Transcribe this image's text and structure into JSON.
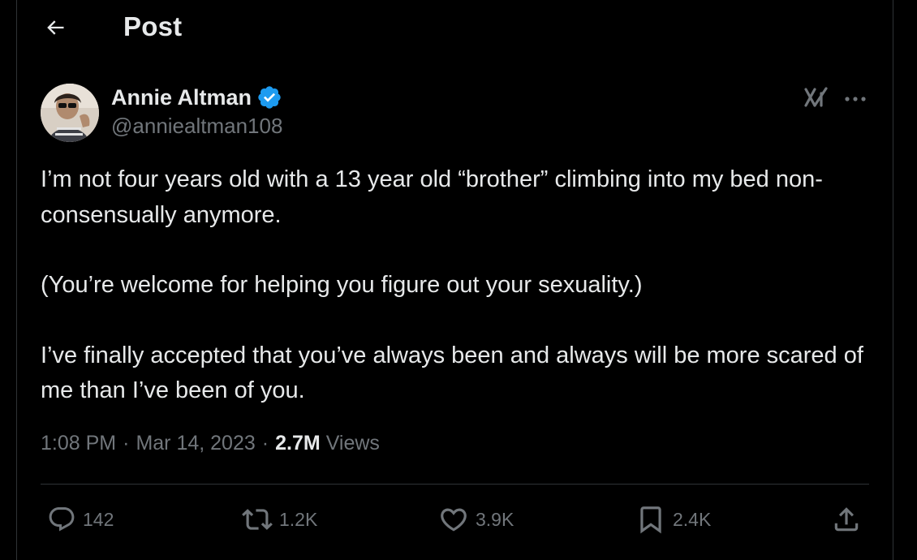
{
  "header": {
    "title": "Post"
  },
  "author": {
    "display_name": "Annie Altman",
    "handle": "@anniealtman108",
    "verified": true
  },
  "tweet": {
    "paragraphs": [
      "I’m not four years old with a 13 year old “brother” climbing into my bed non-consensually anymore.",
      "(You’re welcome for helping you figure out your sexuality.)",
      "I’ve finally accepted that you’ve always been and always will be more scared of me than I’ve been of you."
    ]
  },
  "meta": {
    "time": "1:08 PM",
    "separator": "·",
    "date": "Mar 14, 2023",
    "views_count": "2.7M",
    "views_label": "Views"
  },
  "actions": {
    "replies": "142",
    "reposts": "1.2K",
    "likes": "3.9K",
    "bookmarks": "2.4K"
  },
  "colors": {
    "background": "#000000",
    "text_primary": "#e7e9ea",
    "text_secondary": "#71767b",
    "verified_badge": "#1d9bf0",
    "border": "#2f3336"
  },
  "icons": {
    "back": "arrow-left-icon",
    "verified": "verified-badge-icon",
    "grok": "grok-icon",
    "more": "more-horizontal-icon",
    "reply": "reply-icon",
    "repost": "repost-icon",
    "like": "heart-icon",
    "bookmark": "bookmark-icon",
    "share": "share-icon"
  }
}
